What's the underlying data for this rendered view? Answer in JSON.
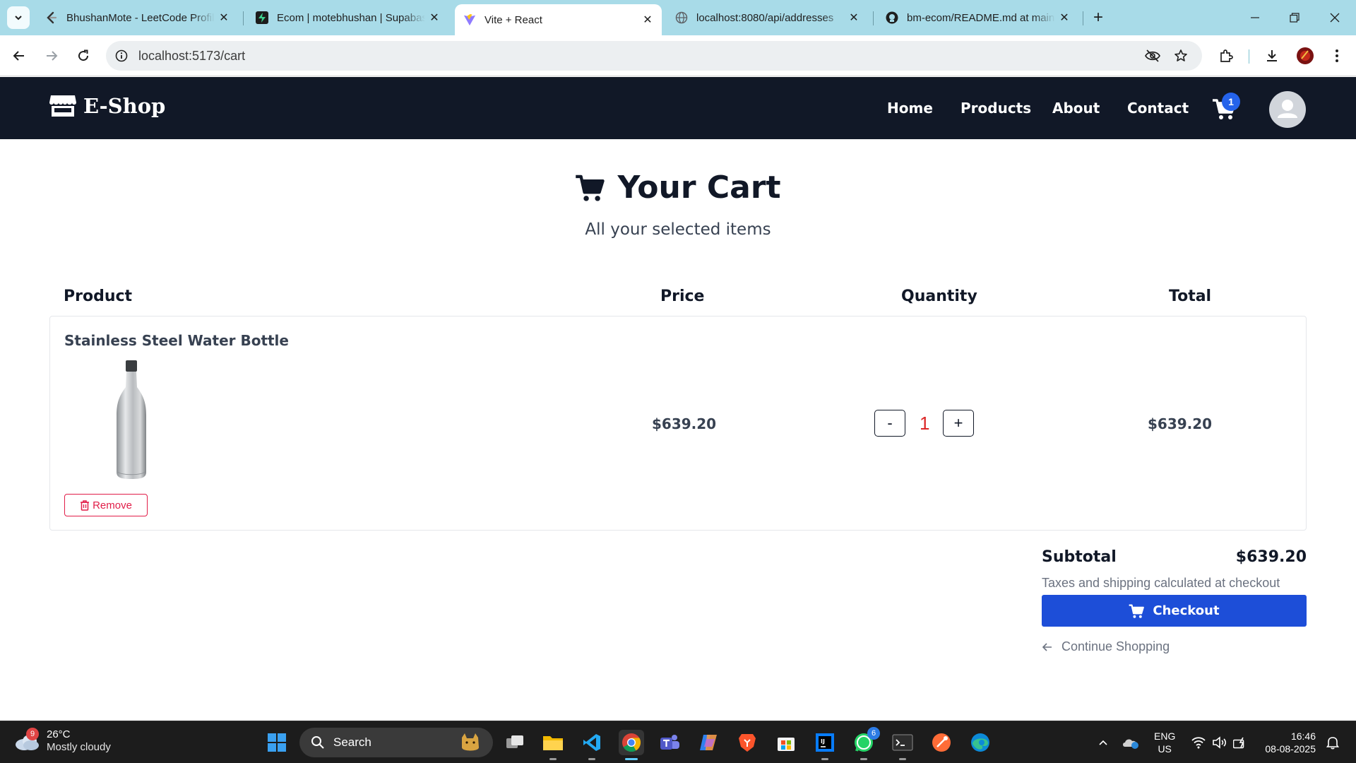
{
  "browser": {
    "tabs": [
      {
        "title": "BhushanMote - LeetCode Profile",
        "favicon": "leetcode-icon",
        "active": false
      },
      {
        "title": "Ecom | motebhushan | Supabase",
        "favicon": "supabase-icon",
        "active": false
      },
      {
        "title": "Vite + React",
        "favicon": "vite-icon",
        "active": true
      },
      {
        "title": "localhost:8080/api/addresses",
        "favicon": "globe-icon",
        "active": false
      },
      {
        "title": "bm-ecom/README.md at main",
        "favicon": "github-icon",
        "active": false
      }
    ],
    "url": "localhost:5173/cart"
  },
  "navbar": {
    "brand": "E-Shop",
    "links": [
      "Home",
      "Products",
      "About",
      "Contact"
    ],
    "cart_count": "1"
  },
  "page": {
    "title": "Your Cart",
    "subtitle": "All your selected items"
  },
  "cart": {
    "headers": {
      "product": "Product",
      "price": "Price",
      "quantity": "Quantity",
      "total": "Total"
    },
    "items": [
      {
        "name": "Stainless Steel Water Bottle",
        "price": "$639.20",
        "quantity": "1",
        "total": "$639.20",
        "remove_label": "Remove",
        "decrement_label": "-",
        "increment_label": "+"
      }
    ]
  },
  "summary": {
    "subtotal_label": "Subtotal",
    "subtotal_value": "$639.20",
    "tax_note": "Taxes and shipping calculated at checkout",
    "checkout_label": "Checkout",
    "continue_label": "Continue Shopping"
  },
  "taskbar": {
    "weather_temp": "26°C",
    "weather_desc": "Mostly cloudy",
    "weather_badge": "9",
    "search_placeholder": "Search",
    "whatsapp_badge": "6",
    "lang_line1": "ENG",
    "lang_line2": "US",
    "time": "16:46",
    "date": "08-08-2025"
  },
  "colors": {
    "navbar_bg": "#111827",
    "tabstrip_bg": "#a8dbe8",
    "accent_blue": "#1d4ed8",
    "remove_red": "#e11d48",
    "qty_red": "#dc2626"
  }
}
